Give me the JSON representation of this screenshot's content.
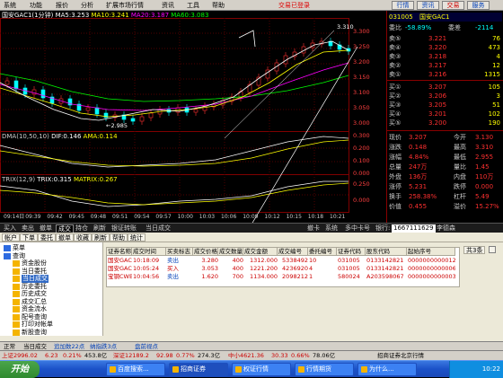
{
  "menubar": {
    "items": [
      "系统",
      "功能",
      "报价",
      "分析",
      "扩展市场行情",
      "资讯",
      "工具",
      "帮助"
    ],
    "trade_status": "交易已登录",
    "buttons": [
      "行情",
      "资讯",
      "交易",
      "服务"
    ]
  },
  "chart": {
    "title": "国安GAC1(1分钟)",
    "ma5": "MA5:3.253",
    "ma10": "MA10:3.241",
    "ma20": "MA20:3.187",
    "ma60": "MA60:3.083",
    "price_ticks": [
      "3.300",
      "3.250",
      "3.200",
      "3.150",
      "3.100",
      "3.050",
      "3.000"
    ],
    "high_label": "3.310",
    "low_label": "←2.985",
    "dma_label": "DMA(10,50,10)",
    "dif": "DIF:0.146",
    "ama": "AMA:0.114",
    "dma_ticks": [
      "0.300",
      "0.200",
      "0.100",
      "0.000"
    ],
    "trix_label": "TRIX(12,9)",
    "trix": "TRIX:0.315",
    "matrix": "MATRIX:0.267",
    "trix_ticks": [
      "0.250",
      "0.000"
    ],
    "time_axis": [
      "09:14日",
      "09:39",
      "09:42",
      "09:45",
      "09:48",
      "09:51",
      "09:54",
      "09:57",
      "10:00",
      "10:03",
      "10:06",
      "10:09",
      "10:12",
      "10:15",
      "10:18",
      "10:21"
    ]
  },
  "quote": {
    "code": "031005",
    "name": "国安GAC1",
    "weibi_label": "委比",
    "weibi": "-58.89%",
    "weicha_label": "委差",
    "weicha": "-2114",
    "asks": [
      {
        "label": "卖⑤",
        "price": "3.221",
        "vol": "76"
      },
      {
        "label": "卖④",
        "price": "3.220",
        "vol": "473"
      },
      {
        "label": "卖③",
        "price": "3.218",
        "vol": "4"
      },
      {
        "label": "卖②",
        "price": "3.217",
        "vol": "12"
      },
      {
        "label": "卖①",
        "price": "3.216",
        "vol": "1315"
      }
    ],
    "bids": [
      {
        "label": "买①",
        "price": "3.207",
        "vol": "105"
      },
      {
        "label": "买②",
        "price": "3.206",
        "vol": "3"
      },
      {
        "label": "买③",
        "price": "3.205",
        "vol": "51"
      },
      {
        "label": "买④",
        "price": "3.201",
        "vol": "102"
      },
      {
        "label": "买⑤",
        "price": "3.200",
        "vol": "190"
      }
    ],
    "stats": [
      {
        "l1": "现价",
        "v1": "3.207",
        "l2": "今开",
        "v2": "3.130"
      },
      {
        "l1": "涨跌",
        "v1": "0.148",
        "l2": "最高",
        "v2": "3.310"
      },
      {
        "l1": "涨幅",
        "v1": "4.84%",
        "l2": "最低",
        "v2": "2.955"
      },
      {
        "l1": "总量",
        "v1": "247万",
        "l2": "量比",
        "v2": "1.45"
      },
      {
        "l1": "外盘",
        "v1": "136万",
        "l2": "内盘",
        "v2": "110万"
      },
      {
        "l1": "涨停",
        "v1": "5.231",
        "l2": "跌停",
        "v2": "0.000"
      },
      {
        "l1": "换手",
        "v1": "258.38%",
        "l2": "杠杆",
        "v2": "5.49"
      },
      {
        "l1": "价值",
        "v1": "0.455",
        "l2": "溢价",
        "v2": "15.27%"
      }
    ]
  },
  "trade_tabs": [
    "买入",
    "卖出",
    "撤单",
    "成交",
    "持仓",
    "刷新",
    "银证转账",
    "当日成交"
  ],
  "trade_tabs_right": [
    "撤卡",
    "系统",
    "多中卡号",
    "银行:",
    "1667111629",
    "李德森"
  ],
  "toolbar": [
    "帐户",
    "下单",
    "委托",
    "撤单",
    "收藏",
    "刷新",
    "帮助",
    "统计"
  ],
  "sidebar": {
    "items": [
      {
        "label": "菜单",
        "indent": 0
      },
      {
        "label": "查询",
        "indent": 0
      },
      {
        "label": "资金股份",
        "indent": 1
      },
      {
        "label": "当日委托",
        "indent": 1
      },
      {
        "label": "当日成交",
        "indent": 1,
        "selected": true
      },
      {
        "label": "历史委托",
        "indent": 1
      },
      {
        "label": "历史成交",
        "indent": 1
      },
      {
        "label": "成交汇总",
        "indent": 1
      },
      {
        "label": "资金流水",
        "indent": 1
      },
      {
        "label": "配号查询",
        "indent": 1
      },
      {
        "label": "打印对帐单",
        "indent": 1
      },
      {
        "label": "新股查询",
        "indent": 1
      }
    ]
  },
  "grid": {
    "headers": [
      "证券名称",
      "成交时间",
      "买卖标志",
      "成交价格",
      "成交数量",
      "成交金额",
      "成交编号",
      "委托编号",
      "证券代码",
      "股东代码",
      "起始序号"
    ],
    "rows": [
      [
        "国安GAC1",
        "10:18:09",
        "卖出",
        "3.280",
        "400",
        "1312.000",
        "5338492",
        "10",
        "031005",
        "0133142821",
        "0000000000012"
      ],
      [
        "国安GAC1",
        "10:05:24",
        "买入",
        "3.053",
        "400",
        "1221.200",
        "4236920",
        "4",
        "031005",
        "0133142821",
        "0000000000006"
      ],
      [
        "宝钢CWB1",
        "10:04:56",
        "卖出",
        "1.620",
        "700",
        "1134.000",
        "2098212",
        "1",
        "580024",
        "A203598067",
        "0000000000003"
      ]
    ],
    "right_buttons": [
      "共3条"
    ]
  },
  "statusbar": {
    "left": "正常",
    "deal": "当日成交",
    "note1": "追加数22点",
    "note2": "纳指跌3点",
    "note3": "盘前视点"
  },
  "ticker": {
    "sh": "上证2996.02",
    "sh_chg": "6.23",
    "sh_pct": "0.21%",
    "sh_amt": "453.8亿",
    "sz_label": "深证12189.2",
    "sz_chg": "92.98",
    "sz_pct": "0.77%",
    "sz_amt": "274.3亿",
    "zx": "中小4621.36",
    "zx_chg": "30.33",
    "zx_pct": "0.66%",
    "zx_amt": "78.06亿",
    "broker": "招商证券北京行情"
  },
  "taskbar": {
    "start": "开始",
    "tasks": [
      "百度搜索...",
      "招商证券",
      "权证行情",
      "行情期货",
      "为什么..."
    ],
    "clock": "10:22"
  },
  "colors": {
    "up": "#ff3030",
    "down": "#00ffff",
    "ma5": "#ffffff",
    "ma10": "#ffff00",
    "ma20": "#ff00ff",
    "ma60": "#00ff00",
    "grid": "#800000"
  }
}
